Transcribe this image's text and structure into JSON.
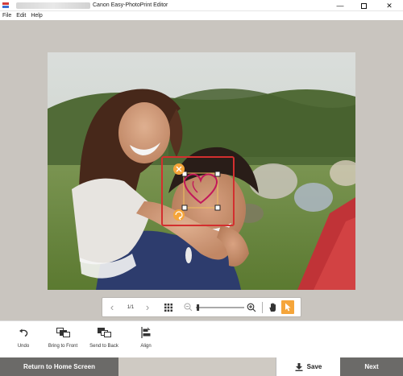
{
  "window": {
    "title": "Canon Easy-PhotoPrint Editor",
    "minimize_glyph": "—",
    "close_glyph": "✕"
  },
  "menu": {
    "items": [
      "File",
      "Edit",
      "Help"
    ]
  },
  "viewbar": {
    "prev_glyph": "‹",
    "page": "1/1",
    "next_glyph": "›",
    "zoom_level": 0.02
  },
  "tools": {
    "undo": "Undo",
    "bring_to_front": "Bring to Front",
    "send_to_back": "Send to Back",
    "align": "Align"
  },
  "footer": {
    "home": "Return to Home Screen",
    "save": "Save",
    "next": "Next"
  },
  "colors": {
    "accent": "#f5a53a",
    "selection": "#d32f2f",
    "heart": "#c2185b",
    "workspace": "#c9c5bf",
    "footer_dark": "#6b6a68"
  },
  "icons": {
    "delete": "close-icon",
    "rotate": "rotate-icon",
    "grid": "grid-icon",
    "zoom_out": "zoom-out-icon",
    "zoom_in": "zoom-in-icon",
    "hand": "hand-icon",
    "select": "pointer-icon",
    "undo": "undo-icon",
    "save": "download-icon"
  }
}
